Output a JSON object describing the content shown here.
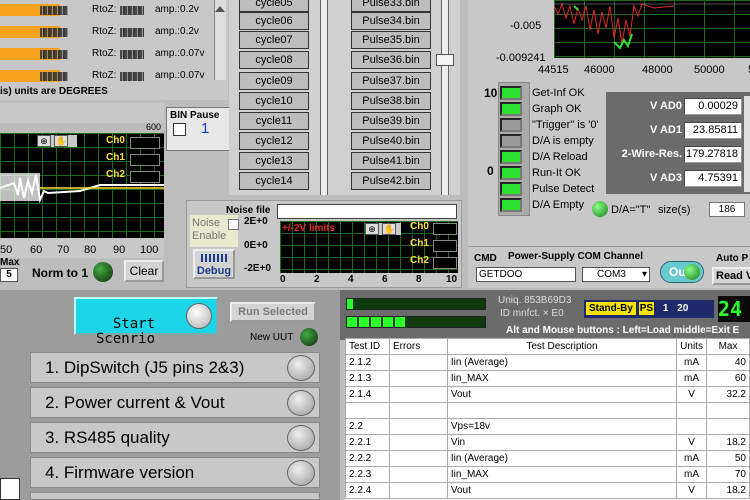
{
  "channels": {
    "rows": [
      {
        "label1": "RtoZ:",
        "label2": "amp.:0.2v"
      },
      {
        "label1": "RtoZ:",
        "label2": "amp.:0.2v"
      },
      {
        "label1": "RtoZ:",
        "label2": "amp.:0.07v"
      },
      {
        "label1": "RtoZ:",
        "label2": "amp.:0.07v"
      }
    ],
    "units_note": "is) units are  DEGREES"
  },
  "bin_pause": {
    "label": "BIN  Pause",
    "value": "1"
  },
  "scope_left": {
    "max_label": "600",
    "legend": [
      "Ch0",
      "Ch1",
      "Ch2"
    ],
    "x_ticks": [
      "50",
      "60",
      "70",
      "80",
      "90",
      "100"
    ],
    "max_text": "Max",
    "max_value": "5",
    "norm_label": "Norm to 1",
    "clear_label": "Clear"
  },
  "cycles": [
    "cycle05",
    "cycle06",
    "cycle07",
    "cycle08",
    "cycle09",
    "cycle10",
    "cycle11",
    "cycle12",
    "cycle13",
    "cycle14"
  ],
  "pulses": [
    "Pulse33.bin",
    "Pulse34.bin",
    "Pulse35.bin",
    "Pulse36.bin",
    "Pulse37.bin",
    "Pulse38.bin",
    "Pulse39.bin",
    "Pulse40.bin",
    "Pulse41.bin",
    "Pulse42.bin"
  ],
  "noise": {
    "file_label": "Noise file",
    "enable_label": "Noise Enable",
    "debug_label": "Debug",
    "limits_label": "+/-2V limits",
    "y_ticks": [
      "2E+0",
      "0E+0",
      "-2E+0"
    ],
    "x_ticks": [
      "0",
      "2",
      "4",
      "6",
      "8",
      "10"
    ],
    "legend": [
      "Ch0",
      "Ch1",
      "Ch2"
    ]
  },
  "top_chart": {
    "y_ticks": [
      "-0.005",
      "-0.009241"
    ],
    "x_ticks": [
      "44515",
      "46000",
      "48000",
      "50000",
      "52000"
    ]
  },
  "status": {
    "scale_top": "10",
    "scale_bottom": "0",
    "items": [
      "Get-Inf OK",
      "Graph OK",
      "\"Trigger\" is '0'",
      "D/A is empty",
      "D/A Reload",
      "Run-It OK",
      "Pulse Detect",
      "D/A Empty"
    ],
    "da_label": "D/A=\"T\"",
    "size_label": "size(s)",
    "size_value": "186"
  },
  "vads": [
    {
      "label": "V AD0",
      "value": "0.00029"
    },
    {
      "label": "V AD1",
      "value": "23.85811"
    },
    {
      "label": "2-Wire-Res.",
      "value": "179.27818"
    },
    {
      "label": "V AD3",
      "value": "4.75391"
    }
  ],
  "cmd": {
    "cmd_label": "CMD",
    "channel_label": "Power-Supply COM Channel",
    "cmd_value": "GETDOO",
    "com_value": "COM3",
    "out_label": "Out",
    "auto_label": "Auto P",
    "read_label": "Read V"
  },
  "scenario": {
    "start_label": "Start\nScenrio",
    "run_selected_label": "Run Selected",
    "new_uut_label": "New UUT",
    "items": [
      "1. DipSwitch (J5 pins 2&3)",
      "2. Power current & Vout",
      "3. RS485 quality",
      "4. Firmware version"
    ]
  },
  "uut": {
    "uniq_label": "Uniq. 853B69D3",
    "id_label": "ID mnfct. × E0",
    "standby_label": "Stand-By",
    "ps_label": "PS",
    "ps_val1": "1",
    "ps_val2": "20",
    "counter": "24",
    "hint": "Alt and Mouse buttons : Left=Load middle=Exit E"
  },
  "results": {
    "headers": [
      "Test ID",
      "Errors",
      "Test Description",
      "Units",
      "Max"
    ],
    "rows": [
      [
        "2.1.2",
        "",
        "Iin (Average)",
        "mA",
        "40"
      ],
      [
        "2.1.3",
        "",
        "Iin_MAX",
        "mA",
        "60"
      ],
      [
        "2.1.4",
        "",
        "Vout",
        "V",
        "32.2"
      ],
      [
        "",
        "",
        "",
        "",
        ""
      ],
      [
        "2.2",
        "",
        "Vps=18v",
        "",
        ""
      ],
      [
        "2.2.1",
        "",
        "Vin",
        "V",
        "18.2"
      ],
      [
        "2.2.2",
        "",
        "Iin (Average)",
        "mA",
        "50"
      ],
      [
        "2.2.3",
        "",
        "Iin_MAX",
        "mA",
        "70"
      ],
      [
        "2.2.4",
        "",
        "Vout",
        "V",
        "18.2"
      ]
    ]
  },
  "colors": {
    "accent_cyan": "#1ad6e8",
    "led_green": "#2ee02e",
    "orange": "#f7a21c",
    "standby_yellow": "#f4e200",
    "counter_green": "#2aff2a"
  }
}
